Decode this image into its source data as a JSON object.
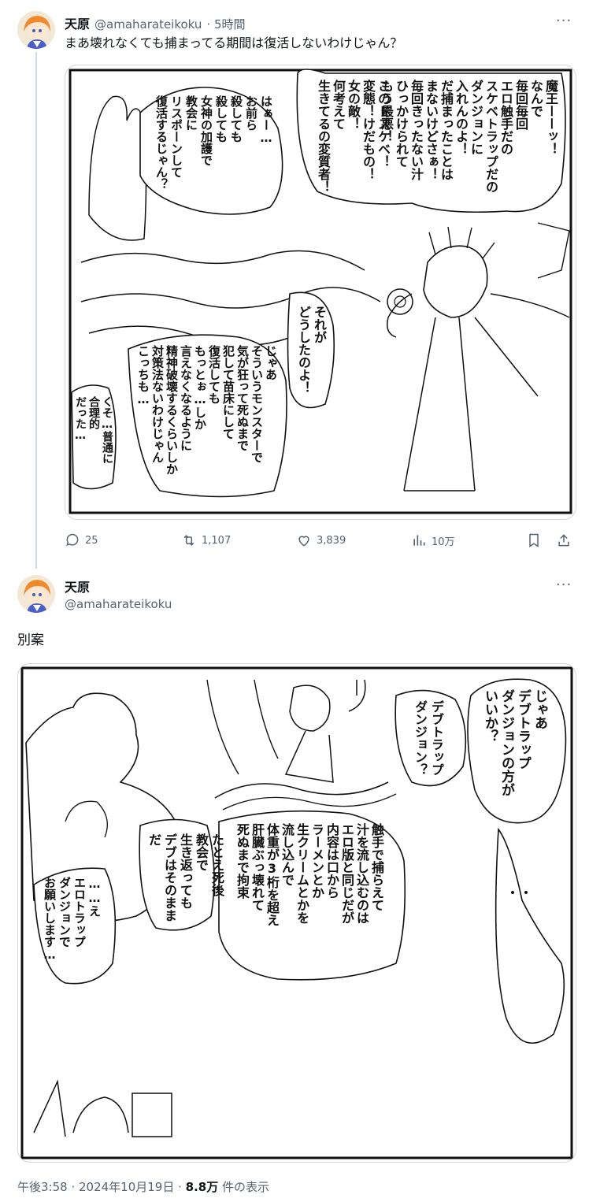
{
  "tweet1": {
    "author_name": "天原",
    "author_handle": "@amaharateikoku",
    "time": "· 5時間",
    "text": "まあ壊れなくても捕まってる期間は復活しないわけじゃん？",
    "more": "···",
    "actions": {
      "replies": "25",
      "retweets": "1,107",
      "likes": "3,839",
      "views": "10万"
    },
    "manga": {
      "bubble_maou": [
        "魔王ーーッ！",
        "なんで",
        "毎回毎回",
        "エロ触手だの",
        "スケベトラップだの",
        "ダンジョンに",
        "入れんのよ！",
        "だ捕まったことは",
        "まないけどさぁ！",
        "毎回きったない汁",
        "ひっかけられて",
        "もう最悪！"
      ],
      "bubble_dosukebe": [
        "このドスケベ！",
        "変態！けだもの！",
        "女の敵！",
        "何考えて",
        "生きてるの変質者！"
      ],
      "bubble_hah": [
        "はぁー…",
        "お前ら",
        "殺しても",
        "殺しても",
        "女神の加護で",
        "教会に",
        "リスポーンして",
        "復活するじゃん？"
      ],
      "bubble_sorega": [
        "それが",
        "どうしたのよ！"
      ],
      "bubble_jaa": [
        "じゃあ",
        "そういうモンスターで",
        "気が狂って死ぬまで",
        "犯して苗床にして",
        "復活しても",
        "もっとぉ…しか",
        "言えなくなるように",
        "精神破壊するくらいしか",
        "対策法ないわけじゃん",
        "こっちも…"
      ],
      "bubble_kuso": [
        "くそ…普通に",
        "合理的",
        "だった…"
      ]
    }
  },
  "tweet2": {
    "author_name": "天原",
    "author_handle": "@amaharateikoku",
    "more": "···",
    "text": "別案",
    "manga": {
      "bubble_jaa": [
        "じゃあ",
        "デブトラップ",
        "ダンジョンの方が",
        "いいか？"
      ],
      "bubble_debu": [
        "デブトラップ",
        "ダンジョン？"
      ],
      "bubble_shokushu": [
        "触手で捕らえて",
        "汁を流し込むのは",
        "エロ版と同じだが",
        "内容は口から",
        "ラーメンとか",
        "生クリームとかを",
        "流し込んで",
        "体重が3桁を超え",
        "肝臓ぶっ壊れて",
        "死ぬまで拘束"
      ],
      "bubble_tatoe": [
        "たとえ死後",
        "教会で",
        "生き返っても",
        "デブはそのままだ"
      ],
      "bubble_erotrap": [
        "……え",
        "エロトラップ",
        "ダンジョンで",
        "お願いします…"
      ]
    },
    "footer": {
      "time": "午後3:58 · 2024年10月19日 · ",
      "views_count": "8.8万",
      "views_label": " 件の表示"
    }
  }
}
